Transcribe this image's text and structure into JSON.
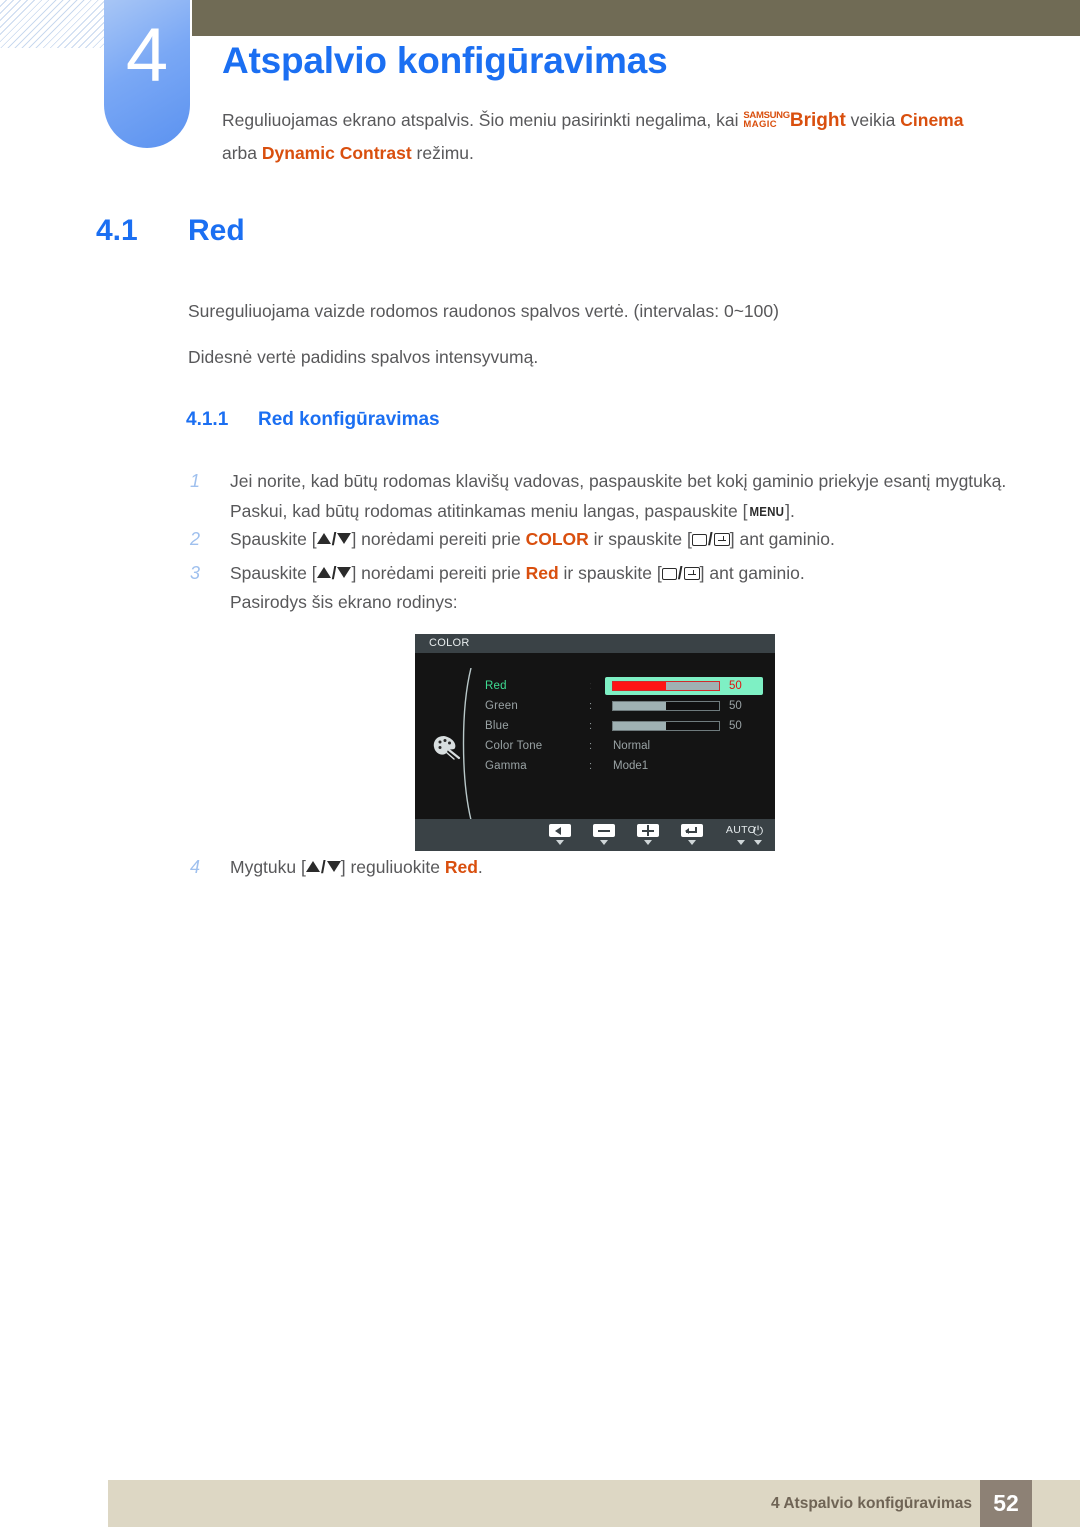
{
  "chapter": {
    "number": "4",
    "title": "Atspalvio konfigūravimas",
    "intro_part1": "Reguliuojamas ekrano atspalvis. Šio meniu pasirinkti negalima, kai ",
    "magic_line1": "SAMSUNG",
    "magic_line2": "MAGIC",
    "bright_label": "Bright",
    "intro_part2": " veikia ",
    "mode_cinema": "Cinema",
    "intro_part3": "arba ",
    "mode_dynamic_contrast": "Dynamic Contrast",
    "intro_part4": " režimu."
  },
  "section": {
    "number": "4.1",
    "title": "Red",
    "paragraph1": "Sureguliuojama vaizde rodomos raudonos spalvos vertė. (intervalas: 0~100)",
    "paragraph2": "Didesnė vertė padidins spalvos intensyvumą."
  },
  "subsection": {
    "number": "4.1.1",
    "title": "Red konfigūravimas"
  },
  "steps": {
    "step1_index": "1",
    "step1_line1": "Jei norite, kad būtų rodomas klavišų vadovas, paspauskite bet kokį gaminio priekyje esantį mygtuką.",
    "step1_line2a": "Paskui, kad būtų rodomas atitinkamas meniu langas, paspauskite [",
    "step1_key": "MENU",
    "step1_line2b": "].",
    "step2_index": "2",
    "step2_a": "Spauskite [",
    "step2_b": "] norėdami pereiti prie ",
    "step2_target": "COLOR",
    "step2_c": " ir spauskite [",
    "step2_d": "] ant gaminio.",
    "step3_index": "3",
    "step3_a": "Spauskite [",
    "step3_b": "] norėdami pereiti prie ",
    "step3_target": "Red",
    "step3_c": " ir spauskite [",
    "step3_d": "] ant gaminio.",
    "step3_followup": "Pasirodys šis ekrano rodinys:",
    "step4_index": "4",
    "step4_a": "Mygtuku [",
    "step4_b": "] reguliuokite ",
    "step4_target": "Red",
    "step4_c": "."
  },
  "osd": {
    "title": "COLOR",
    "rows": [
      {
        "label": "Red",
        "colon": ":",
        "type": "slider",
        "value": "50",
        "fill_percent": 50,
        "selected": true
      },
      {
        "label": "Green",
        "colon": ":",
        "type": "slider",
        "value": "50",
        "fill_percent": 50,
        "selected": false
      },
      {
        "label": "Blue",
        "colon": ":",
        "type": "slider",
        "value": "50",
        "fill_percent": 50,
        "selected": false
      },
      {
        "label": "Color Tone",
        "colon": ":",
        "type": "option",
        "value": "Normal",
        "selected": false
      },
      {
        "label": "Gamma",
        "colon": ":",
        "type": "option",
        "value": "Mode1",
        "selected": false
      }
    ],
    "buttons": [
      {
        "name": "back",
        "glyph": "back",
        "label": ""
      },
      {
        "name": "minus",
        "glyph": "minus",
        "label": ""
      },
      {
        "name": "plus",
        "glyph": "plus",
        "label": ""
      },
      {
        "name": "enter",
        "glyph": "enter",
        "label": ""
      },
      {
        "name": "auto",
        "glyph": "text",
        "label": "AUTO"
      },
      {
        "name": "power",
        "glyph": "power",
        "label": "⏻"
      }
    ]
  },
  "footer": {
    "text": "4 Atspalvio konfigūravimas",
    "page": "52"
  },
  "colors": {
    "heading_blue": "#1b6ff2",
    "accent_orange": "#d94f0e",
    "olive_bar": "#706b55",
    "footer_bar": "#ddd7c4",
    "page_badge": "#8d8175",
    "osd_highlight": "#7ef0c4",
    "osd_red": "#ff1414"
  }
}
